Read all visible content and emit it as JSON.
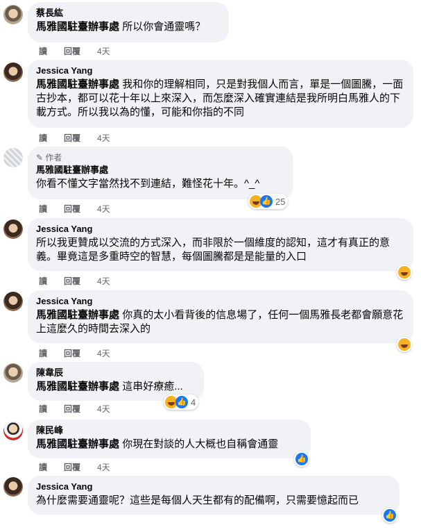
{
  "actions": {
    "read": "讀",
    "reply": "回覆",
    "time": "4天"
  },
  "author_badge": "作者",
  "comments": [
    {
      "name": "蔡長紘",
      "tag": "馬雅國駐臺辦事處",
      "text": "所以你會通靈嗎？"
    },
    {
      "name": "Jessica Yang",
      "tag": "馬雅國駐臺辦事處",
      "text": "我和你的理解相同，只是對我個人而言，單是一個圖騰，一面古抄本，都可以花十年以上來深入，而怎麼深入確實連結是我所明白馬雅人的下載方式。所以我以為的懂，可能和你指的不同"
    },
    {
      "name": "馬雅國駐臺辦事處",
      "tag": "",
      "text": "你看不懂文字當然找不到連結，難怪花十年。^_^",
      "reactions": "25"
    },
    {
      "name": "Jessica Yang",
      "tag": "",
      "text": "所以我更贊成以交流的方式深入，而非限於一個維度的認知，這才有真正的意義。畢竟這是多重時空的智慧，每個圖騰都是是能量的入口"
    },
    {
      "name": "Jessica Yang",
      "tag": "馬雅國駐臺辦事處",
      "text": "你真的太小看背後的信息場了，任何一個馬雅長老都會願意花上這麼久的時間去深入的"
    },
    {
      "name": "陳韋辰",
      "tag": "馬雅國駐臺辦事處",
      "text": "這串好療癒...",
      "reactions": "4"
    },
    {
      "name": "陳民峰",
      "tag": "馬雅國駐臺辦事處",
      "text": "你現在對談的人大概也自稱會通靈"
    },
    {
      "name": "Jessica Yang",
      "tag": "",
      "text": "為什麼需要通靈呢？這些是每個人天生都有的配備啊，只需要憶起而已"
    }
  ]
}
